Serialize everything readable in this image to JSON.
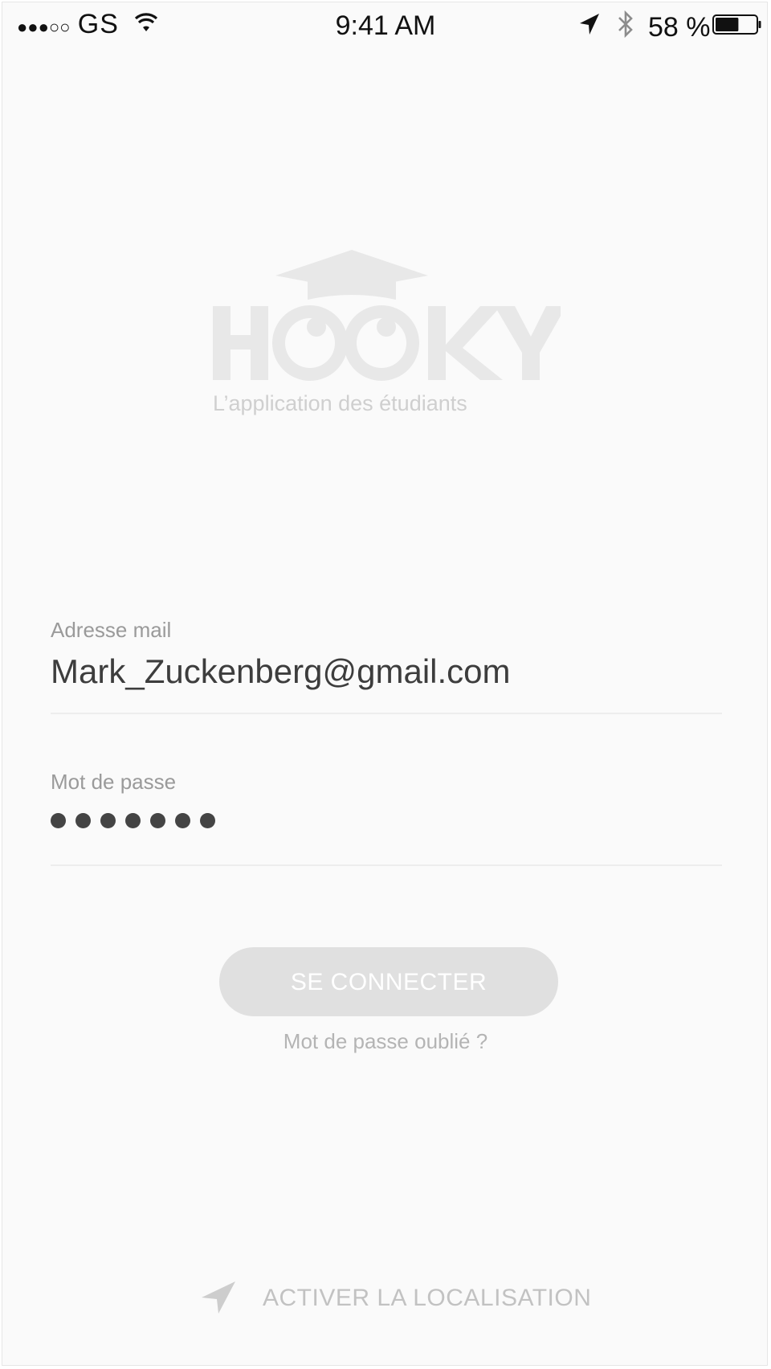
{
  "status_bar": {
    "signal_dots": "●●●○○",
    "carrier": "GS",
    "time": "9:41 AM",
    "battery_percent": "58 %",
    "battery_level": 0.58
  },
  "logo": {
    "name": "HOOKY",
    "tagline": "L’application des étudiants"
  },
  "form": {
    "email_label": "Adresse mail",
    "email_value": "Mark_Zuckenberg@gmail.com",
    "password_label": "Mot de passe",
    "password_length": 7,
    "submit_label": "SE CONNECTER",
    "forgot_label": "Mot de passe oublié ?"
  },
  "location": {
    "label": "ACTIVER LA LOCALISATION"
  },
  "colors": {
    "background": "#fafafa",
    "logo": "#e8e8e8",
    "button": "#e0e0e0",
    "text_dark": "#3d3d3d",
    "text_muted": "#b4b4b4"
  }
}
